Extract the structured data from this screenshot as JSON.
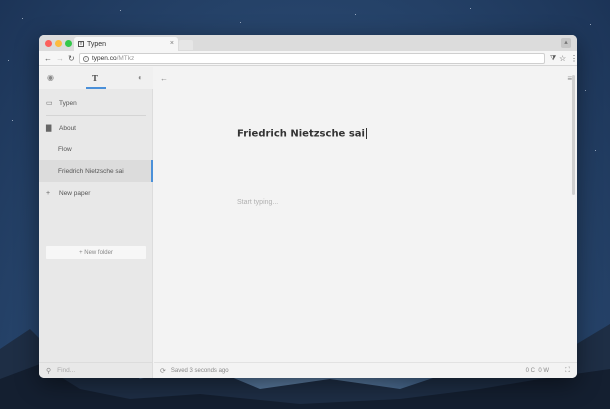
{
  "browser": {
    "tab_title": "Typen",
    "tab_close": "×",
    "url_host": "typen.co",
    "url_path": "/MTkz",
    "back": "←",
    "forward": "→",
    "reload": "↻",
    "star": "☆",
    "filter": "⧩",
    "more": "⋮",
    "profile": "👤"
  },
  "sidebar": {
    "tabs": [
      {
        "name": "profile",
        "icon": "profile-icon",
        "glyph": "◉"
      },
      {
        "name": "typen",
        "icon": "typen-t-icon",
        "glyph": "T"
      },
      {
        "name": "theme",
        "icon": "theme-icon",
        "glyph": "◐"
      }
    ],
    "items": [
      {
        "label": "Typen",
        "icon": "inbox-icon",
        "glyph": "▭"
      },
      {
        "label": "About",
        "icon": "folder-icon",
        "glyph": "▇"
      },
      {
        "label": "Flow"
      },
      {
        "label": "Friedrich Nietzsche sai",
        "selected": true
      },
      {
        "label": "New paper",
        "icon": "plus-icon",
        "glyph": "+"
      }
    ],
    "new_folder": "+ New folder",
    "find_placeholder": "Find..."
  },
  "editor": {
    "title": "Friedrich Nietzsche sai",
    "placeholder": "Start typing...",
    "back_icon": "←",
    "menu_icon": "≡"
  },
  "status": {
    "saved": "Saved 3 seconds ago",
    "char_count": "0 C",
    "word_count": "0 W",
    "fullscreen_icon": "⛶",
    "sync_icon": "⟳",
    "search_icon": "⚲"
  },
  "colors": {
    "accent": "#4a90d9",
    "sidebar_bg": "#e8e8e8",
    "editor_bg": "#f3f3f3"
  }
}
